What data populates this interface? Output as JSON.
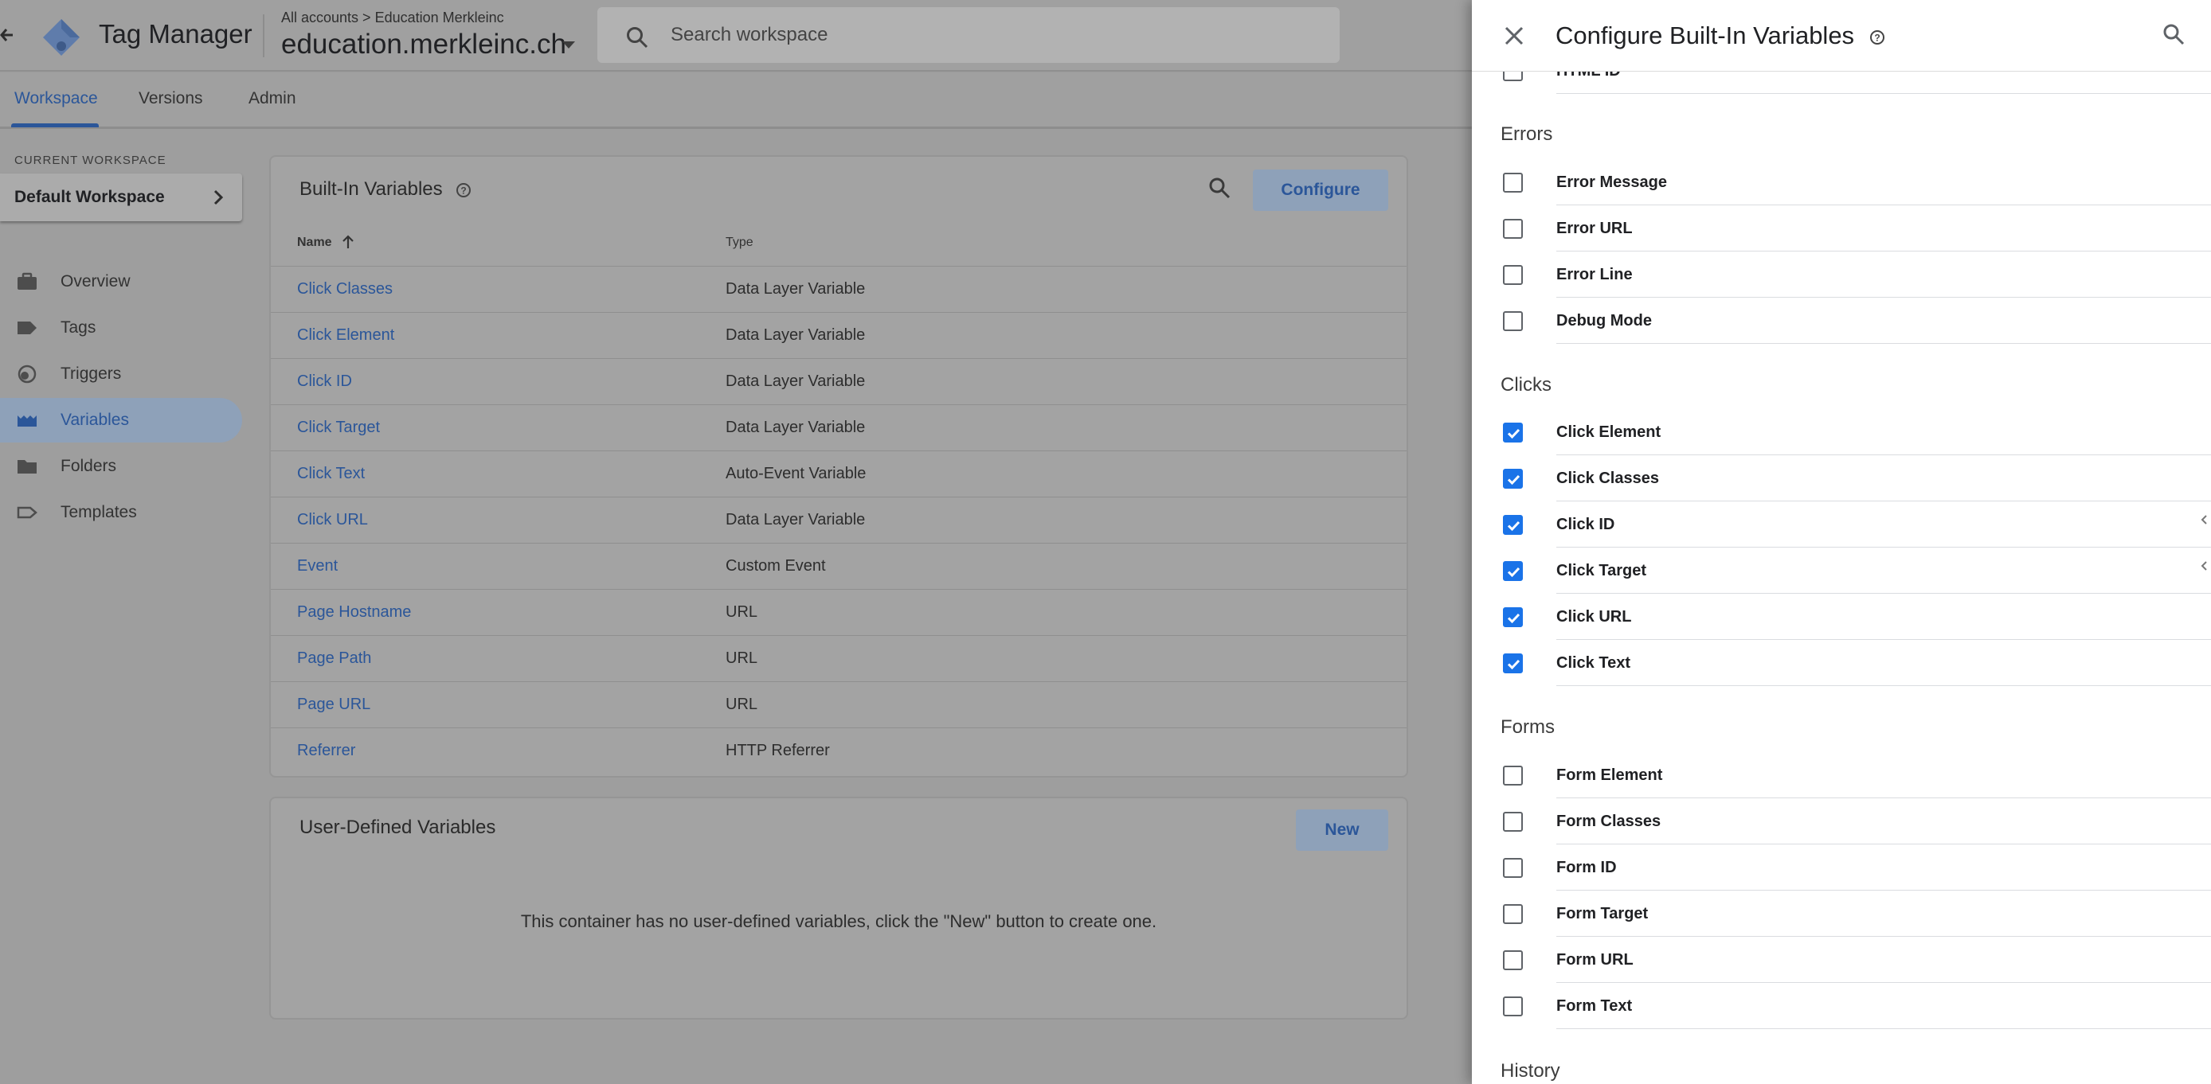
{
  "header": {
    "app_title": "Tag Manager",
    "breadcrumb": "All accounts > Education Merkleinc",
    "container_name": "education.merkleinc.ch",
    "search_placeholder": "Search workspace"
  },
  "nav_tabs": [
    {
      "label": "Workspace",
      "active": true
    },
    {
      "label": "Versions",
      "active": false
    },
    {
      "label": "Admin",
      "active": false
    }
  ],
  "sidebar": {
    "current_workspace_label": "CURRENT WORKSPACE",
    "workspace_name": "Default Workspace",
    "items": [
      {
        "label": "Overview",
        "icon": "briefcase-icon"
      },
      {
        "label": "Tags",
        "icon": "tag-icon"
      },
      {
        "label": "Triggers",
        "icon": "trigger-icon"
      },
      {
        "label": "Variables",
        "icon": "variables-icon",
        "active": true
      },
      {
        "label": "Folders",
        "icon": "folder-icon"
      },
      {
        "label": "Templates",
        "icon": "template-icon"
      }
    ]
  },
  "builtin_card": {
    "title": "Built-In Variables",
    "configure_label": "Configure",
    "col_name": "Name",
    "col_type": "Type",
    "rows": [
      {
        "name": "Click Classes",
        "type": "Data Layer Variable"
      },
      {
        "name": "Click Element",
        "type": "Data Layer Variable"
      },
      {
        "name": "Click ID",
        "type": "Data Layer Variable"
      },
      {
        "name": "Click Target",
        "type": "Data Layer Variable"
      },
      {
        "name": "Click Text",
        "type": "Auto-Event Variable"
      },
      {
        "name": "Click URL",
        "type": "Data Layer Variable"
      },
      {
        "name": "Event",
        "type": "Custom Event"
      },
      {
        "name": "Page Hostname",
        "type": "URL"
      },
      {
        "name": "Page Path",
        "type": "URL"
      },
      {
        "name": "Page URL",
        "type": "URL"
      },
      {
        "name": "Referrer",
        "type": "HTTP Referrer"
      }
    ]
  },
  "user_card": {
    "title": "User-Defined Variables",
    "new_label": "New",
    "empty_message": "This container has no user-defined variables, click the \"New\" button to create one."
  },
  "panel": {
    "title": "Configure Built-In Variables",
    "partial_item": "HTML ID",
    "sections": [
      {
        "heading": "Errors",
        "items": [
          {
            "label": "Error Message",
            "checked": false
          },
          {
            "label": "Error URL",
            "checked": false
          },
          {
            "label": "Error Line",
            "checked": false
          },
          {
            "label": "Debug Mode",
            "checked": false
          }
        ]
      },
      {
        "heading": "Clicks",
        "items": [
          {
            "label": "Click Element",
            "checked": true
          },
          {
            "label": "Click Classes",
            "checked": true
          },
          {
            "label": "Click ID",
            "checked": true
          },
          {
            "label": "Click Target",
            "checked": true
          },
          {
            "label": "Click URL",
            "checked": true
          },
          {
            "label": "Click Text",
            "checked": true
          }
        ]
      },
      {
        "heading": "Forms",
        "items": [
          {
            "label": "Form Element",
            "checked": false
          },
          {
            "label": "Form Classes",
            "checked": false
          },
          {
            "label": "Form ID",
            "checked": false
          },
          {
            "label": "Form Target",
            "checked": false
          },
          {
            "label": "Form URL",
            "checked": false
          },
          {
            "label": "Form Text",
            "checked": false
          }
        ]
      },
      {
        "heading": "History",
        "items": []
      }
    ]
  },
  "colors": {
    "accent": "#1a73e8",
    "link_dimmed": "#2b5699",
    "overlay_bg": "#9e9e9e"
  }
}
